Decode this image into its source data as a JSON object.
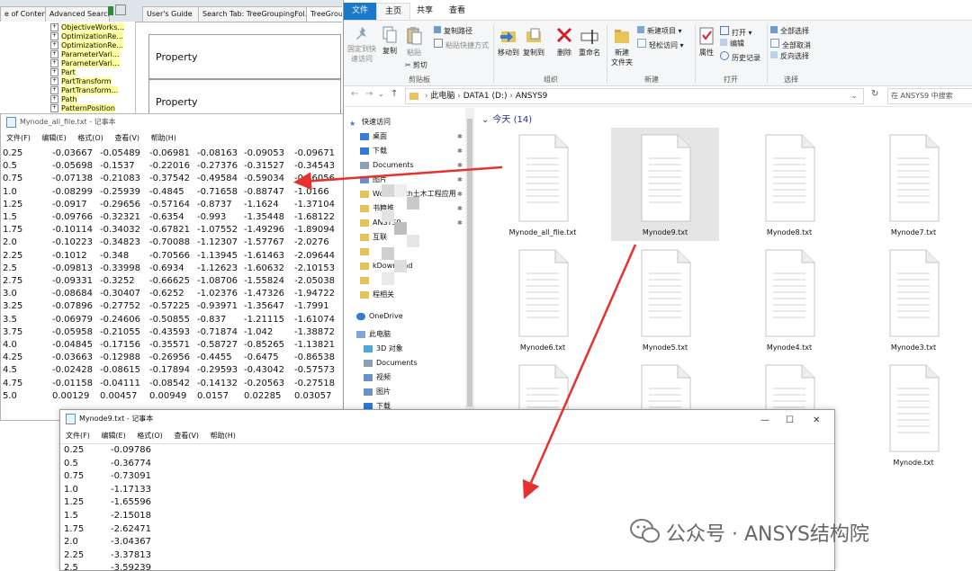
{
  "help": {
    "tabs": [
      "e of Contents",
      "Advanced Search",
      "User's Guide",
      "Search Tab: TreeGroupingFol...",
      "TreeGroup"
    ],
    "tree_items": [
      "ObjectiveWorks...",
      "OptimizationRe...",
      "OptimizationRe...",
      "ParameterVari...",
      "ParameterVari...",
      "Part",
      "PartTransform",
      "PartTransform...",
      "Path",
      "PatternPosition"
    ],
    "property_rows": [
      "Property",
      "Property"
    ]
  },
  "notepad1": {
    "title": "Mynode_all_file.txt - 记事本",
    "menu": [
      "文件(F)",
      "编辑(E)",
      "格式(O)",
      "查看(V)",
      "帮助(H)"
    ],
    "rows": [
      [
        "0.25",
        "-0.03667",
        "-0.05489",
        "-0.06981",
        "-0.08163",
        "-0.09053",
        "-0.09671"
      ],
      [
        "0.5",
        "-0.05698",
        "-0.1537",
        "-0.22016",
        "-0.27376",
        "-0.31527",
        "-0.34543"
      ],
      [
        "0.75",
        "-0.07138",
        "-0.21083",
        "-0.37542",
        "-0.49584",
        "-0.59034",
        "-0.66056"
      ],
      [
        "1.0",
        "-0.08299",
        "-0.25939",
        "-0.4845",
        "-0.71658",
        "-0.88747",
        "-1.0166"
      ],
      [
        "1.25",
        "-0.0917",
        "-0.29656",
        "-0.57164",
        "-0.8737",
        "-1.1624",
        "-1.37104"
      ],
      [
        "1.5",
        "-0.09766",
        "-0.32321",
        "-0.6354",
        "-0.993",
        "-1.35448",
        "-1.68122"
      ],
      [
        "1.75",
        "-0.10114",
        "-0.34032",
        "-0.67821",
        "-1.07552",
        "-1.49296",
        "-1.89094"
      ],
      [
        "2.0",
        "-0.10223",
        "-0.34823",
        "-0.70088",
        "-1.12307",
        "-1.57767",
        "-2.0276"
      ],
      [
        "2.25",
        "-0.1012",
        "-0.348",
        "-0.70566",
        "-1.13945",
        "-1.61463",
        "-2.09644"
      ],
      [
        "2.5",
        "-0.09813",
        "-0.33998",
        "-0.6934",
        "-1.12623",
        "-1.60632",
        "-2.10153"
      ],
      [
        "2.75",
        "-0.09331",
        "-0.3252",
        "-0.66625",
        "-1.08706",
        "-1.55824",
        "-2.05038"
      ],
      [
        "3.0",
        "-0.08684",
        "-0.30407",
        "-0.6252",
        "-1.02376",
        "-1.47326",
        "-1.94722"
      ],
      [
        "3.25",
        "-0.07896",
        "-0.27752",
        "-0.57225",
        "-0.93971",
        "-1.35647",
        "-1.7991"
      ],
      [
        "3.5",
        "-0.06979",
        "-0.24606",
        "-0.50855",
        "-0.837",
        "-1.21115",
        "-1.61074"
      ],
      [
        "3.75",
        "-0.05958",
        "-0.21055",
        "-0.43593",
        "-0.71874",
        "-1.042",
        "-1.38872"
      ],
      [
        "4.0",
        "-0.04845",
        "-0.17156",
        "-0.35571",
        "-0.58727",
        "-0.85265",
        "-1.13821"
      ],
      [
        "4.25",
        "-0.03663",
        "-0.12988",
        "-0.26956",
        "-0.4455",
        "-0.6475",
        "-0.86538"
      ],
      [
        "4.5",
        "-0.02428",
        "-0.08615",
        "-0.17894",
        "-0.29593",
        "-0.43042",
        "-0.57573"
      ],
      [
        "4.75",
        "-0.01158",
        "-0.04111",
        "-0.08542",
        "-0.14132",
        "-0.20563",
        "-0.27518"
      ],
      [
        "5.0",
        "0.00129",
        "0.00457",
        "0.00949",
        "0.0157",
        "0.02285",
        "0.03057"
      ]
    ]
  },
  "explorer": {
    "tabs": {
      "file": "文件",
      "home": "主页",
      "share": "共享",
      "view": "查看"
    },
    "ribbon": {
      "pin": "固定到快\n速访问",
      "copy": "复制",
      "paste": "粘贴",
      "copy_path": "复制路径",
      "paste_shortcut": "粘贴快捷方式",
      "cut": "剪切",
      "move_to": "移动到",
      "copy_to": "复制到",
      "delete": "删除",
      "rename": "重命名",
      "new_folder": "新建\n文件夹",
      "new_item": "新建项目",
      "easy_access": "轻松访问",
      "properties": "属性",
      "open": "打开",
      "edit": "编辑",
      "history": "历史记录",
      "select_all": "全部选择",
      "select_none": "全部取消",
      "invert": "反向选择",
      "groups": [
        "剪贴板",
        "组织",
        "新建",
        "打开",
        "选择"
      ]
    },
    "address": {
      "parts": [
        "此电脑",
        "DATA1 (D:)",
        "ANSYS9"
      ],
      "search_placeholder": "在 ANSYS9 中搜索"
    },
    "nav": {
      "quick_access": "快速访问",
      "items": [
        "桌面",
        "下载",
        "Documents",
        "图片",
        "Workbench土木工程应用",
        "书籍推",
        "ANSYS9",
        "互联",
        "",
        "kDownload",
        "",
        "程相关"
      ],
      "onedrive": "OneDrive",
      "this_pc": "此电脑",
      "pc_items": [
        "3D 对象",
        "Documents",
        "视频",
        "图片",
        "下载"
      ]
    },
    "group_header": "今天 (14)",
    "files": [
      "Mynode_all_file.txt",
      "Mynode9.txt",
      "Mynode8.txt",
      "Mynode7.txt",
      "Mynode6.txt",
      "Mynode5.txt",
      "Mynode4.txt",
      "Mynode3.txt",
      "",
      "",
      "",
      "Mynode.txt"
    ],
    "selected_file": "Mynode9.txt"
  },
  "notepad2": {
    "title": "Mynode9.txt - 记事本",
    "menu": [
      "文件(F)",
      "编辑(E)",
      "格式(O)",
      "查看(V)",
      "帮助(H)"
    ],
    "rows": [
      [
        "0.25",
        "-0.09786"
      ],
      [
        "0.5",
        "-0.36774"
      ],
      [
        "0.75",
        "-0.73091"
      ],
      [
        "1.0",
        "-1.17133"
      ],
      [
        "1.25",
        "-1.65596"
      ],
      [
        "1.5",
        "-2.15018"
      ],
      [
        "1.75",
        "-2.62471"
      ],
      [
        "2.0",
        "-3.04367"
      ],
      [
        "2.25",
        "-3.37813"
      ],
      [
        "2.5",
        "-3.59239"
      ]
    ]
  },
  "watermark": "公众号 · ANSYS结构院",
  "colors": {
    "accent": "#1979ca",
    "arrow": "#e8302e",
    "folder": "#e9c25a"
  }
}
